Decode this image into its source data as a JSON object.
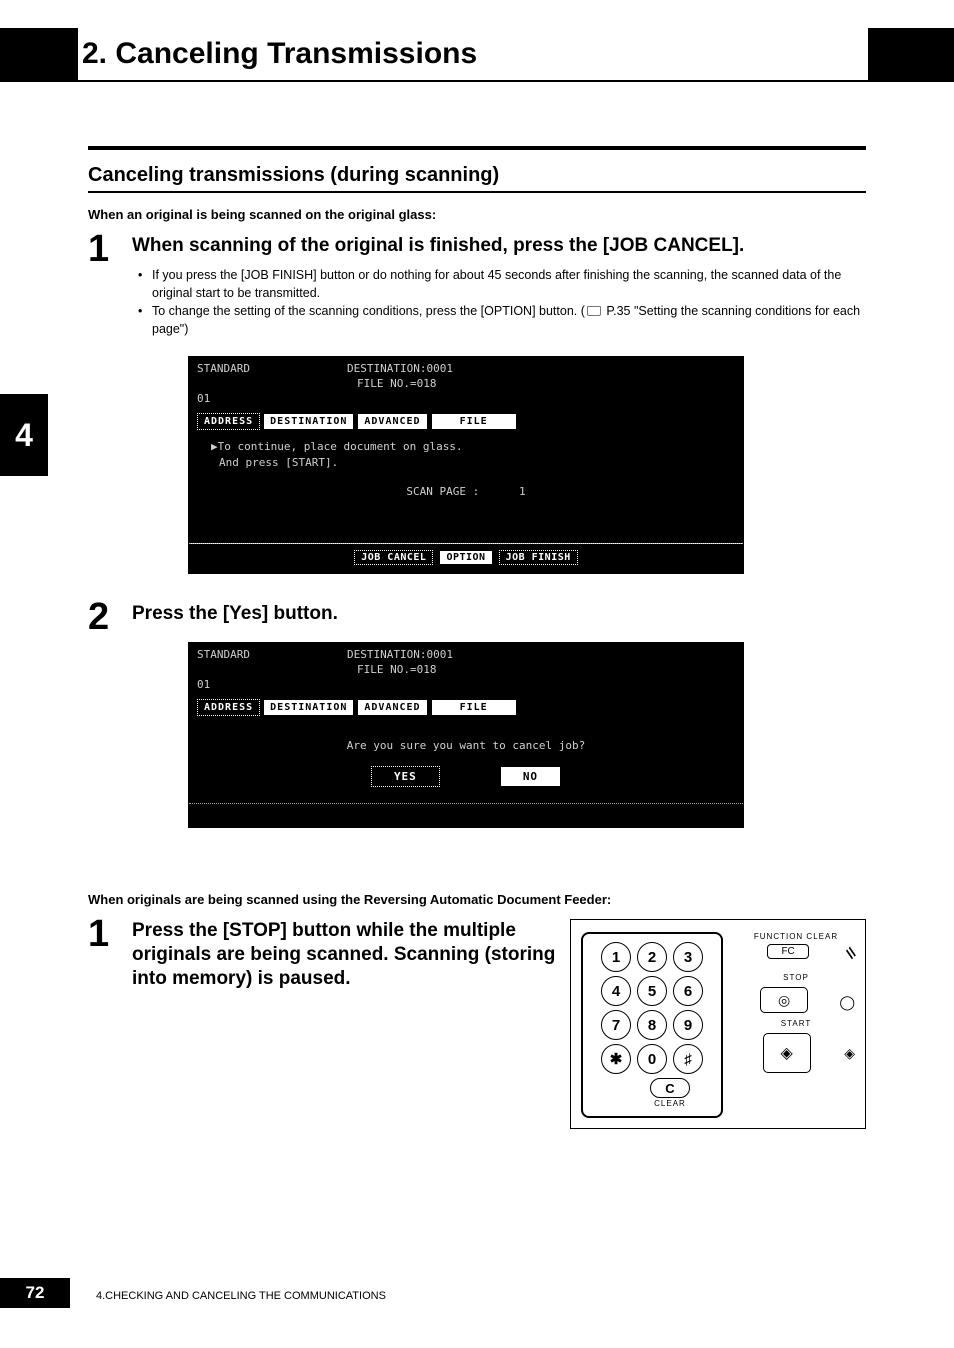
{
  "chapter": {
    "number": "2.",
    "title": "Canceling Transmissions"
  },
  "side_tab": "4",
  "section_title": "Canceling transmissions (during scanning)",
  "lead1": "When an original is being scanned on the original glass:",
  "step1": {
    "num": "1",
    "title": "When scanning of the original is finished, press the [JOB CANCEL].",
    "bullets": [
      "If you press the [JOB FINISH] button or do nothing for about 45 seconds after finishing the scanning, the scanned data of the original start to be transmitted.",
      "To change the setting of the scanning conditions, press the [OPTION] button. ( 📖 P.35 \"Setting the scanning conditions for each page\")"
    ]
  },
  "lcd1": {
    "standard": "STANDARD",
    "dest_label": "DESTINATION:",
    "dest_val": "0001",
    "file_label": "FILE NO.=",
    "file_val": "018",
    "line": "01",
    "tabs": [
      "ADDRESS",
      "DESTINATION",
      "ADVANCED",
      "FILE"
    ],
    "msg1": "▶To continue, place document on glass.",
    "msg2": "And press [START].",
    "scan_label": "SCAN PAGE :",
    "scan_val": "1",
    "btns": [
      "JOB CANCEL",
      "OPTION",
      "JOB FINISH"
    ]
  },
  "step2": {
    "num": "2",
    "title": "Press the [Yes] button."
  },
  "lcd2": {
    "standard": "STANDARD",
    "dest_label": "DESTINATION:",
    "dest_val": "0001",
    "file_label": "FILE NO.=",
    "file_val": "018",
    "line": "01",
    "tabs": [
      "ADDRESS",
      "DESTINATION",
      "ADVANCED",
      "FILE"
    ],
    "confirm": "Are you sure you want to cancel job?",
    "yes": "YES",
    "no": "NO"
  },
  "lead2": "When originals are being scanned using the Reversing Automatic Document Feeder:",
  "step3": {
    "num": "1",
    "title": "Press the [STOP] button while the multiple originals are being scanned. Scanning (storing into memory) is paused."
  },
  "keypad": {
    "keys": [
      [
        "1",
        "2",
        "3"
      ],
      [
        "4",
        "5",
        "6"
      ],
      [
        "7",
        "8",
        "9"
      ],
      [
        "✱",
        "0",
        "♯"
      ]
    ],
    "c": "C",
    "clear": "CLEAR",
    "function_clear": "FUNCTION CLEAR",
    "fc": "FC",
    "stop": "STOP",
    "start": "START"
  },
  "footer": {
    "page": "72",
    "text": "4.CHECKING AND CANCELING THE COMMUNICATIONS"
  }
}
